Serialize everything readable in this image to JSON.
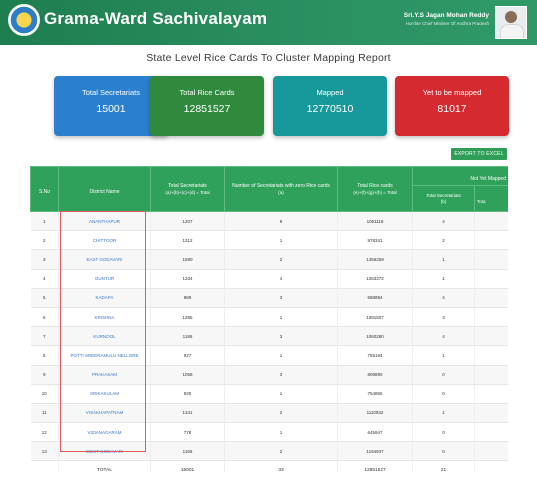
{
  "header": {
    "title": "Grama-Ward Sachivalayam",
    "cm_name": "Sri.Y.S Jagan Mohan Reddy",
    "cm_designation": "Hon'ble Chief Minister Of Andhra Pradesh",
    "logo_icon": "ap-emblem-icon",
    "avatar_icon": "cm-photo-icon",
    "color": "#2a8f60"
  },
  "report_title": "State Level Rice Cards To Cluster Mapping Report",
  "cards": [
    {
      "label": "Total Secretariats",
      "value": "15001",
      "color": "#2a7fcf"
    },
    {
      "label": "Total Rice Cards",
      "value": "12851527",
      "color": "#2f8a3e"
    },
    {
      "label": "Mapped",
      "value": "12770510",
      "color": "#17999b"
    },
    {
      "label": "Yet to be mapped",
      "value": "81017",
      "color": "#d52b30"
    }
  ],
  "export_label": "EXPORT TO EXCEL",
  "table": {
    "headers": {
      "sno": "S.No",
      "district": "District Name",
      "total_secretariats": "Total Secretariats",
      "total_secretariats_formula": "(a)+(b)+(c)+(d) = Total",
      "zero_cards": "Number of Secretariats with zero Rice cards",
      "zero_cards_formula": "(a)",
      "total_cards": "Total Rice cards",
      "total_cards_formula": "(e)+(f)+(g)+(h) = Total",
      "not_yet_mapped": "Not Yet Mapped",
      "nym_total_secretariats": "Total Secretariats",
      "nym_total_secretariats_formula": "(b)",
      "nym_next": "Tota"
    },
    "rows": [
      {
        "sno": "1",
        "district": "ANANTHAPUR",
        "total": "1207",
        "zero": "9",
        "cards": "1061119",
        "nym": "4"
      },
      {
        "sno": "2",
        "district": "CHITTOOR",
        "total": "1312",
        "zero": "1",
        "cards": "978341",
        "nym": "2"
      },
      {
        "sno": "3",
        "district": "EAST GODAVARI",
        "total": "1590",
        "zero": "2",
        "cards": "1456259",
        "nym": "1"
      },
      {
        "sno": "4",
        "district": "GUNTUR",
        "total": "1334",
        "zero": "4",
        "cards": "1263372",
        "nym": "1"
      },
      {
        "sno": "5",
        "district": "KADAPA",
        "total": "889",
        "zero": "3",
        "cards": "688894",
        "nym": "4"
      },
      {
        "sno": "6",
        "district": "KRISHNA",
        "total": "1285",
        "zero": "1",
        "cards": "1081507",
        "nym": "3"
      },
      {
        "sno": "7",
        "district": "KURNOOL",
        "total": "1186",
        "zero": "3",
        "cards": "1060280",
        "nym": "4"
      },
      {
        "sno": "8",
        "district": "POTTI SREERAMULU NELLORE",
        "total": "927",
        "zero": "1",
        "cards": "755194",
        "nym": "1"
      },
      {
        "sno": "9",
        "district": "PRAKASAM",
        "total": "1058",
        "zero": "3",
        "cards": "809890",
        "nym": "0"
      },
      {
        "sno": "10",
        "district": "SRIKAKULAM",
        "total": "930",
        "zero": "1",
        "cards": "754855",
        "nym": "0"
      },
      {
        "sno": "11",
        "district": "VISAKHAPATNAM",
        "total": "1341",
        "zero": "2",
        "cards": "1110932",
        "nym": "1"
      },
      {
        "sno": "12",
        "district": "VIZIANAGARAM",
        "total": "778",
        "zero": "1",
        "cards": "645947",
        "nym": "0"
      },
      {
        "sno": "13",
        "district": "WEST GODAVARI",
        "total": "1165",
        "zero": "2",
        "cards": "1184937",
        "nym": "0"
      }
    ],
    "total_row": {
      "label": "TOTAL",
      "total": "15001",
      "zero": "33",
      "cards": "12851527",
      "nym": "21"
    }
  }
}
